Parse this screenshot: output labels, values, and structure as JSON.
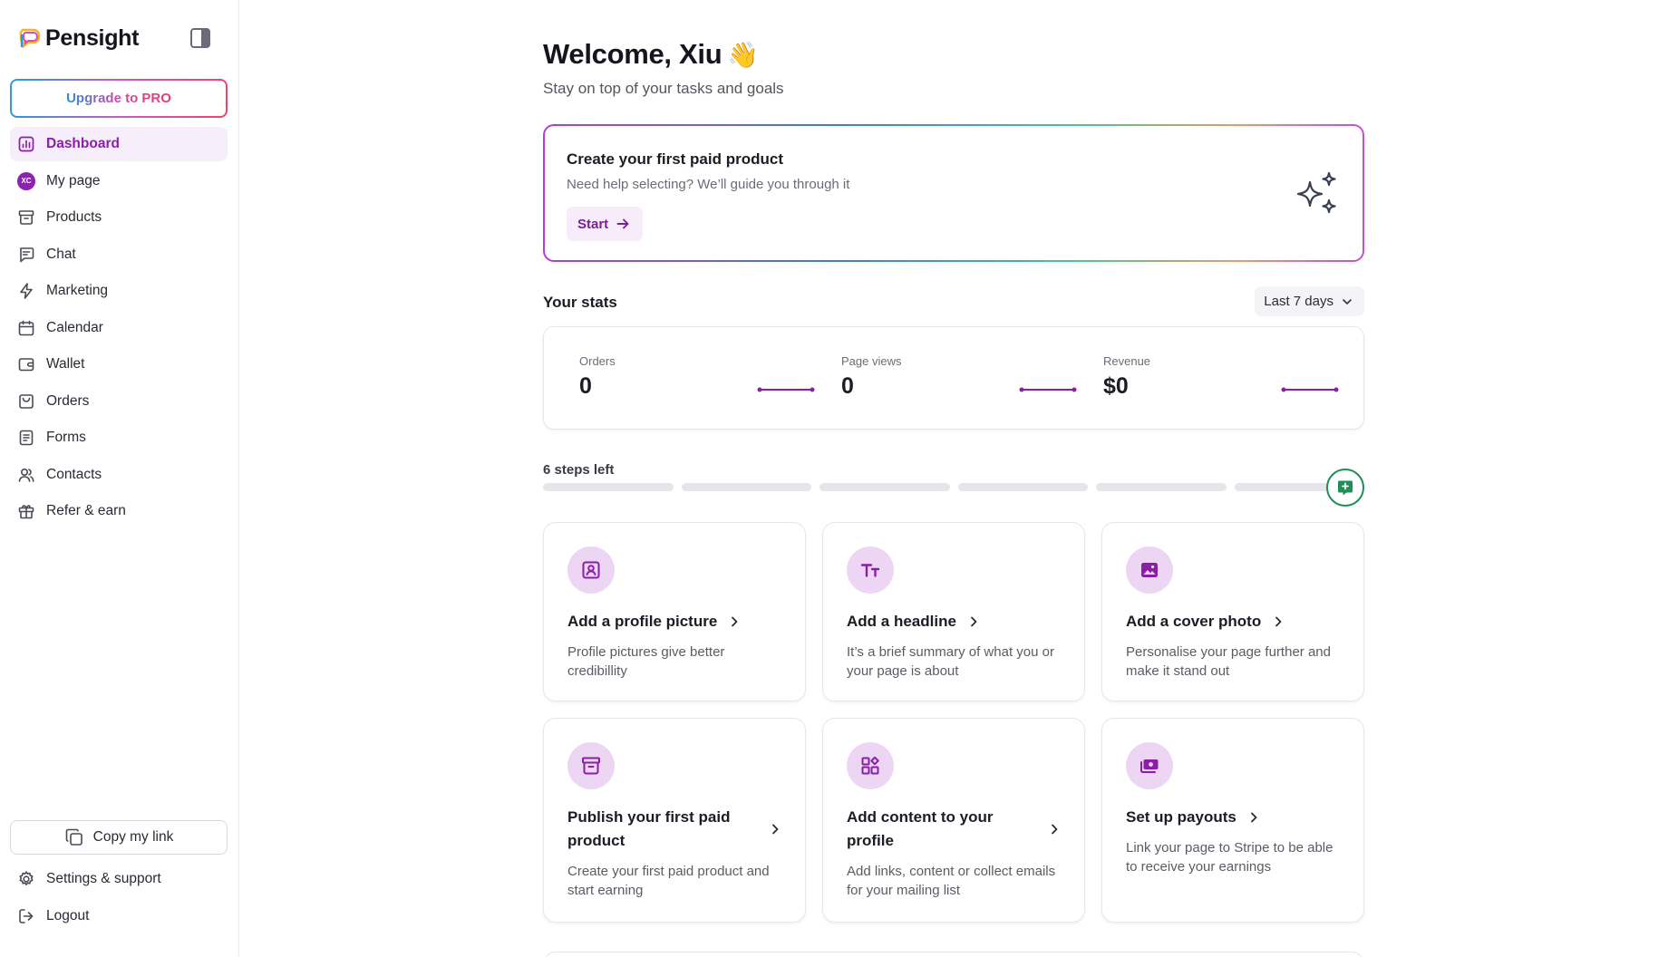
{
  "brand": {
    "name": "Pensight"
  },
  "sidebar": {
    "upgrade_label": "Upgrade to PRO",
    "items": [
      {
        "label": "Dashboard",
        "icon": "chart-bars-icon",
        "active": true
      },
      {
        "label": "My page",
        "icon": "avatar-initials",
        "avatar_text": "XC"
      },
      {
        "label": "Products",
        "icon": "archive-box-icon"
      },
      {
        "label": "Chat",
        "icon": "chat-bubble-icon"
      },
      {
        "label": "Marketing",
        "icon": "lightning-icon"
      },
      {
        "label": "Calendar",
        "icon": "calendar-icon"
      },
      {
        "label": "Wallet",
        "icon": "wallet-icon"
      },
      {
        "label": "Orders",
        "icon": "bag-icon"
      },
      {
        "label": "Forms",
        "icon": "form-document-icon"
      },
      {
        "label": "Contacts",
        "icon": "users-icon"
      },
      {
        "label": "Refer & earn",
        "icon": "gift-icon"
      }
    ],
    "copy_link_label": "Copy my link",
    "bottom_items": [
      {
        "label": "Settings & support",
        "icon": "gear-icon"
      },
      {
        "label": "Logout",
        "icon": "logout-icon"
      }
    ]
  },
  "main": {
    "welcome_title": "Welcome, Xiu",
    "welcome_emoji": "👋",
    "welcome_subtitle": "Stay on top of your tasks and goals",
    "promo": {
      "title": "Create your first paid product",
      "subtitle": "Need help selecting? We’ll guide you through it",
      "button_label": "Start"
    },
    "stats": {
      "title": "Your stats",
      "range_label": "Last 7 days",
      "items": [
        {
          "label": "Orders",
          "value": "0"
        },
        {
          "label": "Page views",
          "value": "0"
        },
        {
          "label": "Revenue",
          "value": "$0"
        }
      ]
    },
    "steps": {
      "label": "6 steps left",
      "total": 6,
      "completed": 0
    },
    "cards": [
      {
        "title": "Add a profile picture",
        "desc": "Profile pictures give better credibillity",
        "icon": "profile-picture-icon"
      },
      {
        "title": "Add a headline",
        "desc": "It’s a brief summary of what you or your page is about",
        "icon": "text-size-icon"
      },
      {
        "title": "Add a cover photo",
        "desc": "Personalise your page further and make it stand out",
        "icon": "image-icon"
      },
      {
        "title": "Publish your first paid product",
        "desc": "Create your first paid product and start earning",
        "icon": "archive-box-icon"
      },
      {
        "title": "Add content to your profile",
        "desc": "Add links, content or collect emails for your mailing list",
        "icon": "widgets-icon"
      },
      {
        "title": "Set up payouts",
        "desc": "Link your page to Stripe to be able to receive your earnings",
        "icon": "payout-icon"
      }
    ]
  },
  "colors": {
    "accent": "#8a1fa6",
    "accent_bg": "#f7eefb",
    "icon_circle": "#ecd6f4",
    "help_green": "#1f8e57"
  }
}
